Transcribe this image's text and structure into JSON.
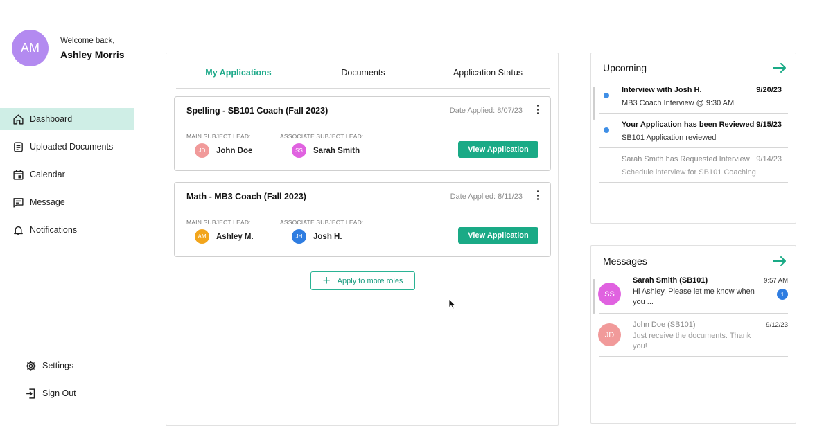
{
  "user": {
    "initials": "AM",
    "welcome": "Welcome back,",
    "name": "Ashley Morris",
    "avatar_color": "#b38af0"
  },
  "sidebar": {
    "items": [
      {
        "label": "Dashboard",
        "icon": "home-icon",
        "active": true
      },
      {
        "label": "Uploaded Documents",
        "icon": "document-icon"
      },
      {
        "label": "Calendar",
        "icon": "calendar-icon"
      },
      {
        "label": "Message",
        "icon": "message-icon"
      },
      {
        "label": "Notifications",
        "icon": "bell-icon"
      }
    ],
    "bottom": [
      {
        "label": "Settings",
        "icon": "gear-icon"
      },
      {
        "label": "Sign Out",
        "icon": "sign-out-icon"
      }
    ]
  },
  "tabs": [
    {
      "label": "My Applications",
      "active": true
    },
    {
      "label": "Documents"
    },
    {
      "label": "Application Status"
    }
  ],
  "applications": [
    {
      "title": "Spelling - SB101 Coach (Fall 2023)",
      "date": "Date Applied: 8/07/23",
      "main_label": "MAIN SUBJECT LEAD:",
      "main_initials": "JD",
      "main_name": "John Doe",
      "main_color": "#f19a9a",
      "assoc_label": "ASSOCIATE SUBJECT LEAD:",
      "assoc_initials": "SS",
      "assoc_name": "Sarah Smith",
      "assoc_color": "#e062e0",
      "button": "View Application"
    },
    {
      "title": "Math - MB3 Coach (Fall 2023)",
      "date": "Date Applied: 8/11/23",
      "main_label": "MAIN SUBJECT LEAD:",
      "main_initials": "AM",
      "main_name": "Ashley M.",
      "main_color": "#f2a51c",
      "assoc_label": "ASSOCIATE SUBJECT LEAD:",
      "assoc_initials": "JH",
      "assoc_name": "Josh H.",
      "assoc_color": "#2f7de1",
      "button": "View Application"
    }
  ],
  "apply_more": "Apply to more roles",
  "upcoming": {
    "title": "Upcoming",
    "items": [
      {
        "title": "Interview with Josh H.",
        "date": "9/20/23",
        "sub": "MB3 Coach Interview @ 9:30 AM",
        "unread": true
      },
      {
        "title": "Your Application has been Reviewed",
        "date": "9/15/23",
        "sub": "SB101 Application reviewed",
        "unread": true
      },
      {
        "title": "Sarah Smith has Requested Interview",
        "date": "9/14/23",
        "sub": "Schedule interview for SB101 Coaching",
        "unread": false
      }
    ]
  },
  "messages": {
    "title": "Messages",
    "items": [
      {
        "initials": "SS",
        "name": "Sarah Smith (SB101)",
        "time": "9:57 AM",
        "text": "Hi Ashley, Please let me know when you ...",
        "badge": "1",
        "color": "#e062e0",
        "unread": true
      },
      {
        "initials": "JD",
        "name": "John Doe (SB101)",
        "time": "9/12/23",
        "text": "Just receive the documents. Thank you!",
        "color": "#f19a9a",
        "unread": false
      }
    ]
  },
  "colors": {
    "accent": "#1aaa86",
    "active_nav_bg": "#cfeee6",
    "unread_dot": "#3f8fe6"
  }
}
